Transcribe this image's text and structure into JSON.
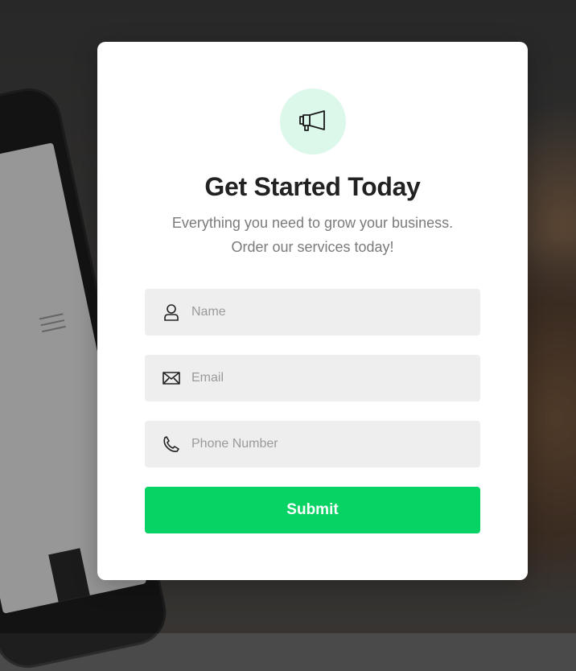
{
  "form": {
    "title": "Get Started Today",
    "subtitle_line1": "Everything you need to grow your business.",
    "subtitle_line2": "Order our services today!",
    "icon": "megaphone-icon",
    "fields": [
      {
        "icon": "user-icon",
        "placeholder": "Name",
        "value": ""
      },
      {
        "icon": "envelope-icon",
        "placeholder": "Email",
        "value": ""
      },
      {
        "icon": "phone-icon",
        "placeholder": "Phone Number",
        "value": ""
      }
    ],
    "submit_label": "Submit"
  },
  "colors": {
    "accent": "#07d264",
    "icon_circle_bg": "#dcf8ea",
    "field_bg": "#eeeeee",
    "card_bg": "#ffffff"
  }
}
